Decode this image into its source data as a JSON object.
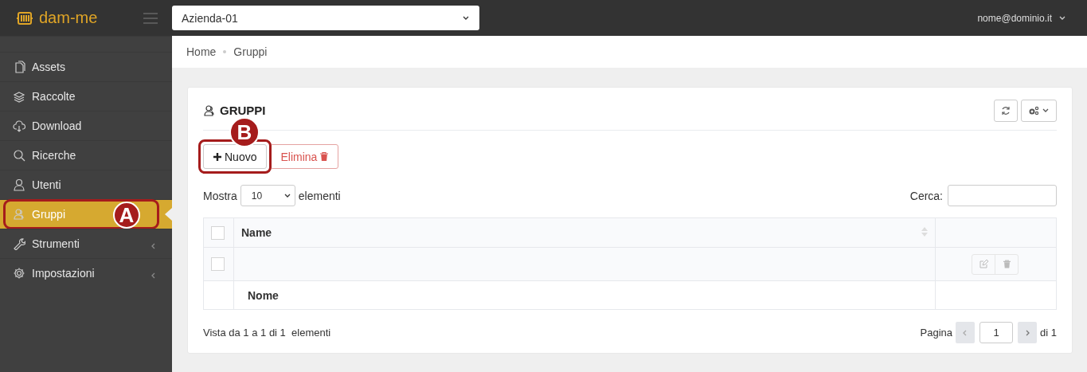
{
  "header": {
    "logo": "dam-me",
    "company_select": "Azienda-01",
    "user": "nome@dominio.it"
  },
  "sidebar": {
    "items": [
      {
        "label": "Assets",
        "selected": false,
        "expandable": false
      },
      {
        "label": "Raccolte",
        "selected": false,
        "expandable": false
      },
      {
        "label": "Download",
        "selected": false,
        "expandable": false
      },
      {
        "label": "Ricerche",
        "selected": false,
        "expandable": false
      },
      {
        "label": "Utenti",
        "selected": false,
        "expandable": false
      },
      {
        "label": "Gruppi",
        "selected": true,
        "expandable": false,
        "callout": "A"
      },
      {
        "label": "Strumenti",
        "selected": false,
        "expandable": true
      },
      {
        "label": "Impostazioni",
        "selected": false,
        "expandable": true
      }
    ]
  },
  "breadcrumb": [
    "Home",
    "Gruppi"
  ],
  "panel": {
    "title": "GRUPPI",
    "buttons": [
      {
        "label": "Nuovo",
        "kind": "new",
        "callout": "B"
      },
      {
        "label": "Elimina",
        "kind": "delete"
      }
    ],
    "length": {
      "before": "Mostra",
      "value": "10",
      "after": "elementi"
    },
    "search_label": "Cerca:",
    "table": {
      "header_checked": false,
      "column": "Name",
      "rows": [
        {
          "checked": false
        }
      ],
      "footer": "Nome"
    },
    "info": "Vista da 1 a 1 di 1  elementi",
    "pagination": {
      "label": "Pagina",
      "page": "1",
      "of": "di 1"
    }
  }
}
